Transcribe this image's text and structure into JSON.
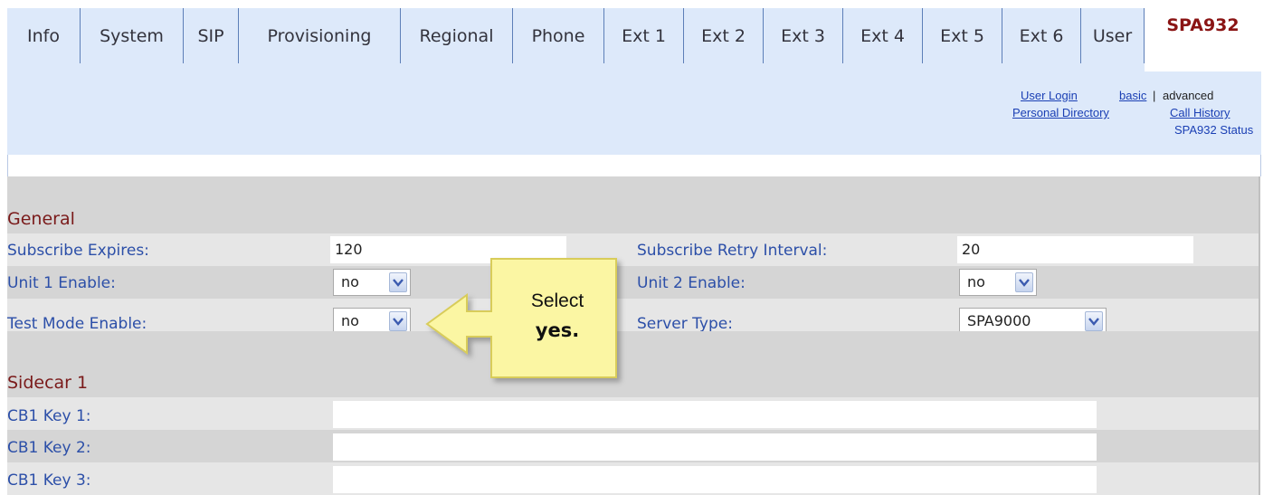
{
  "tabs": [
    {
      "label": "Info"
    },
    {
      "label": "System"
    },
    {
      "label": "SIP"
    },
    {
      "label": "Provisioning"
    },
    {
      "label": "Regional"
    },
    {
      "label": "Phone"
    },
    {
      "label": "Ext 1"
    },
    {
      "label": "Ext 2"
    },
    {
      "label": "Ext 3"
    },
    {
      "label": "Ext 4"
    },
    {
      "label": "Ext 5"
    },
    {
      "label": "Ext 6"
    },
    {
      "label": "User"
    },
    {
      "label": "SPA932",
      "active": true
    }
  ],
  "header_links": {
    "user_login": "User Login",
    "basic": "basic",
    "separator": "|",
    "advanced": "advanced",
    "personal_directory": "Personal Directory",
    "call_history": "Call History",
    "spa932_status": "SPA932 Status"
  },
  "general": {
    "title": "General",
    "subscribe_expires": {
      "label": "Subscribe Expires:",
      "value": "120"
    },
    "subscribe_retry_interval": {
      "label": "Subscribe Retry Interval:",
      "value": "20"
    },
    "unit1_enable": {
      "label": "Unit 1 Enable:",
      "value": "no"
    },
    "unit2_enable": {
      "label": "Unit 2 Enable:",
      "value": "no"
    },
    "test_mode_enable": {
      "label": "Test Mode Enable:",
      "value": "no"
    },
    "server_type": {
      "label": "Server Type:",
      "value": "SPA9000"
    }
  },
  "sidecar1": {
    "title": "Sidecar 1",
    "keys": [
      {
        "label": "CB1 Key 1:",
        "value": ""
      },
      {
        "label": "CB1 Key 2:",
        "value": ""
      },
      {
        "label": "CB1 Key 3:",
        "value": ""
      }
    ]
  },
  "callout": {
    "line1": "Select",
    "line2": "yes."
  },
  "colors": {
    "tab_background": "#dde9fa",
    "tab_active_text": "#8a1414",
    "label_blue": "#2c4fa8",
    "section_red": "#7a1a1a",
    "callout_fill": "#fbf6a3",
    "callout_border": "#d8cc5a"
  },
  "icons": {
    "dropdown": "chevron-down-icon",
    "callout": "arrow-left-callout"
  }
}
